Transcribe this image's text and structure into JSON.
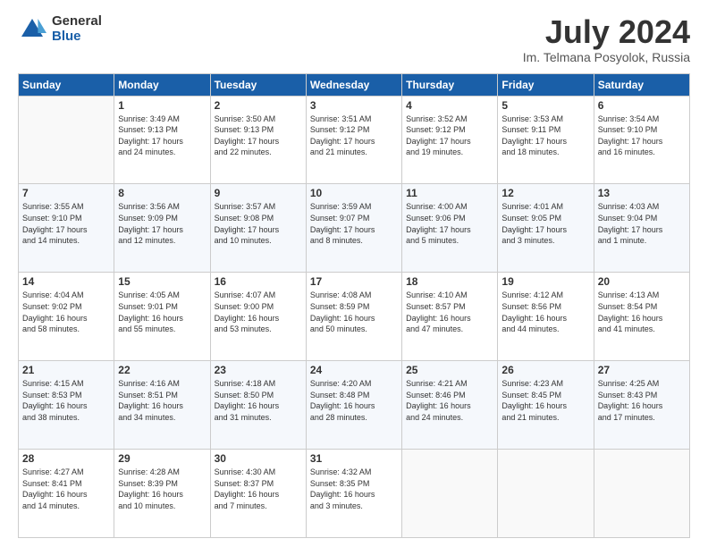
{
  "header": {
    "logo": {
      "general": "General",
      "blue": "Blue"
    },
    "title": "July 2024",
    "subtitle": "Im. Telmana Posyolok, Russia"
  },
  "columns": [
    "Sunday",
    "Monday",
    "Tuesday",
    "Wednesday",
    "Thursday",
    "Friday",
    "Saturday"
  ],
  "weeks": [
    [
      {
        "day": "",
        "info": ""
      },
      {
        "day": "1",
        "info": "Sunrise: 3:49 AM\nSunset: 9:13 PM\nDaylight: 17 hours\nand 24 minutes."
      },
      {
        "day": "2",
        "info": "Sunrise: 3:50 AM\nSunset: 9:13 PM\nDaylight: 17 hours\nand 22 minutes."
      },
      {
        "day": "3",
        "info": "Sunrise: 3:51 AM\nSunset: 9:12 PM\nDaylight: 17 hours\nand 21 minutes."
      },
      {
        "day": "4",
        "info": "Sunrise: 3:52 AM\nSunset: 9:12 PM\nDaylight: 17 hours\nand 19 minutes."
      },
      {
        "day": "5",
        "info": "Sunrise: 3:53 AM\nSunset: 9:11 PM\nDaylight: 17 hours\nand 18 minutes."
      },
      {
        "day": "6",
        "info": "Sunrise: 3:54 AM\nSunset: 9:10 PM\nDaylight: 17 hours\nand 16 minutes."
      }
    ],
    [
      {
        "day": "7",
        "info": "Sunrise: 3:55 AM\nSunset: 9:10 PM\nDaylight: 17 hours\nand 14 minutes."
      },
      {
        "day": "8",
        "info": "Sunrise: 3:56 AM\nSunset: 9:09 PM\nDaylight: 17 hours\nand 12 minutes."
      },
      {
        "day": "9",
        "info": "Sunrise: 3:57 AM\nSunset: 9:08 PM\nDaylight: 17 hours\nand 10 minutes."
      },
      {
        "day": "10",
        "info": "Sunrise: 3:59 AM\nSunset: 9:07 PM\nDaylight: 17 hours\nand 8 minutes."
      },
      {
        "day": "11",
        "info": "Sunrise: 4:00 AM\nSunset: 9:06 PM\nDaylight: 17 hours\nand 5 minutes."
      },
      {
        "day": "12",
        "info": "Sunrise: 4:01 AM\nSunset: 9:05 PM\nDaylight: 17 hours\nand 3 minutes."
      },
      {
        "day": "13",
        "info": "Sunrise: 4:03 AM\nSunset: 9:04 PM\nDaylight: 17 hours\nand 1 minute."
      }
    ],
    [
      {
        "day": "14",
        "info": "Sunrise: 4:04 AM\nSunset: 9:02 PM\nDaylight: 16 hours\nand 58 minutes."
      },
      {
        "day": "15",
        "info": "Sunrise: 4:05 AM\nSunset: 9:01 PM\nDaylight: 16 hours\nand 55 minutes."
      },
      {
        "day": "16",
        "info": "Sunrise: 4:07 AM\nSunset: 9:00 PM\nDaylight: 16 hours\nand 53 minutes."
      },
      {
        "day": "17",
        "info": "Sunrise: 4:08 AM\nSunset: 8:59 PM\nDaylight: 16 hours\nand 50 minutes."
      },
      {
        "day": "18",
        "info": "Sunrise: 4:10 AM\nSunset: 8:57 PM\nDaylight: 16 hours\nand 47 minutes."
      },
      {
        "day": "19",
        "info": "Sunrise: 4:12 AM\nSunset: 8:56 PM\nDaylight: 16 hours\nand 44 minutes."
      },
      {
        "day": "20",
        "info": "Sunrise: 4:13 AM\nSunset: 8:54 PM\nDaylight: 16 hours\nand 41 minutes."
      }
    ],
    [
      {
        "day": "21",
        "info": "Sunrise: 4:15 AM\nSunset: 8:53 PM\nDaylight: 16 hours\nand 38 minutes."
      },
      {
        "day": "22",
        "info": "Sunrise: 4:16 AM\nSunset: 8:51 PM\nDaylight: 16 hours\nand 34 minutes."
      },
      {
        "day": "23",
        "info": "Sunrise: 4:18 AM\nSunset: 8:50 PM\nDaylight: 16 hours\nand 31 minutes."
      },
      {
        "day": "24",
        "info": "Sunrise: 4:20 AM\nSunset: 8:48 PM\nDaylight: 16 hours\nand 28 minutes."
      },
      {
        "day": "25",
        "info": "Sunrise: 4:21 AM\nSunset: 8:46 PM\nDaylight: 16 hours\nand 24 minutes."
      },
      {
        "day": "26",
        "info": "Sunrise: 4:23 AM\nSunset: 8:45 PM\nDaylight: 16 hours\nand 21 minutes."
      },
      {
        "day": "27",
        "info": "Sunrise: 4:25 AM\nSunset: 8:43 PM\nDaylight: 16 hours\nand 17 minutes."
      }
    ],
    [
      {
        "day": "28",
        "info": "Sunrise: 4:27 AM\nSunset: 8:41 PM\nDaylight: 16 hours\nand 14 minutes."
      },
      {
        "day": "29",
        "info": "Sunrise: 4:28 AM\nSunset: 8:39 PM\nDaylight: 16 hours\nand 10 minutes."
      },
      {
        "day": "30",
        "info": "Sunrise: 4:30 AM\nSunset: 8:37 PM\nDaylight: 16 hours\nand 7 minutes."
      },
      {
        "day": "31",
        "info": "Sunrise: 4:32 AM\nSunset: 8:35 PM\nDaylight: 16 hours\nand 3 minutes."
      },
      {
        "day": "",
        "info": ""
      },
      {
        "day": "",
        "info": ""
      },
      {
        "day": "",
        "info": ""
      }
    ]
  ]
}
